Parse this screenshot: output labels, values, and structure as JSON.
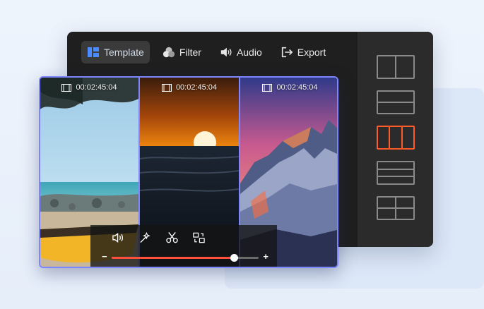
{
  "toolbar": {
    "template_label": "Template",
    "filter_label": "Filter",
    "audio_label": "Audio",
    "export_label": "Export"
  },
  "layouts": [
    "split-2-vertical",
    "split-2-horizontal",
    "split-3-vertical",
    "split-3-horizontal",
    "split-4-grid"
  ],
  "active_layout": "split-3-vertical",
  "panes": [
    {
      "timecode": "00:02:45:04",
      "scene": "beach with yellow boat"
    },
    {
      "timecode": "00:02:45:04",
      "scene": "sunset over sea"
    },
    {
      "timecode": "00:02:45:04",
      "scene": "snowy mountain at dusk"
    }
  ],
  "controls": {
    "icons": [
      "volume-icon",
      "magic-icon",
      "scissors-icon",
      "replace-icon"
    ],
    "minus_label": "−",
    "plus_label": "+",
    "progress": 0.83
  },
  "colors": {
    "accent": "#ff5a2a",
    "selection": "#7d86ff",
    "panel": "#1f1f1f"
  }
}
